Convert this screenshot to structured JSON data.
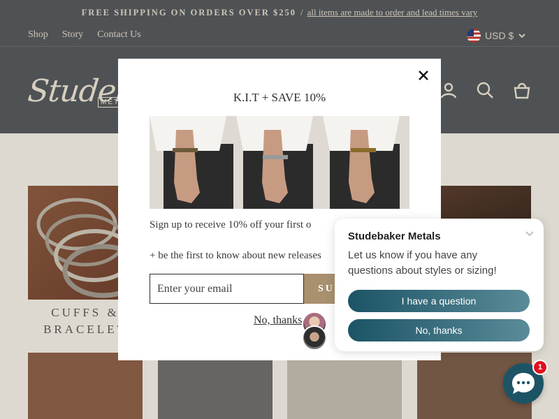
{
  "announcement": {
    "strong": "FREE SHIPPING ON ORDERS OVER $250",
    "separator": "/",
    "link": "all items are made to order and lead times vary"
  },
  "nav": {
    "links": [
      "Shop",
      "Story",
      "Contact Us"
    ],
    "currency": "USD $"
  },
  "header": {
    "logo_script": "Studeba",
    "logo_sub": "METAL"
  },
  "collections": {
    "cuffs_title_line1": "CUFFS &",
    "cuffs_title_line2": "BRACELET"
  },
  "modal": {
    "title": "K.I.T + SAVE 10%",
    "signup_text": "Sign up to receive 10% off your first o",
    "first_text": "+ be the first to know about new releases",
    "email_placeholder": "Enter your email",
    "submit_label": "SU",
    "no_thanks": "No, thanks"
  },
  "chat": {
    "name": "Studebaker Metals",
    "message": "Let us know if you have any questions about styles or sizing!",
    "btn_question": "I have a question",
    "btn_no": "No, thanks",
    "badge_count": "1"
  },
  "colors": {
    "header_bg": "#54585a",
    "page_bg": "#ebe7de",
    "submit_bg": "#a9906f",
    "chat_accent": "#1c5466",
    "badge": "#e0101e"
  },
  "icons": [
    "chevron-down-icon",
    "account-icon",
    "search-icon",
    "cart-icon",
    "close-icon",
    "chat-icon"
  ]
}
